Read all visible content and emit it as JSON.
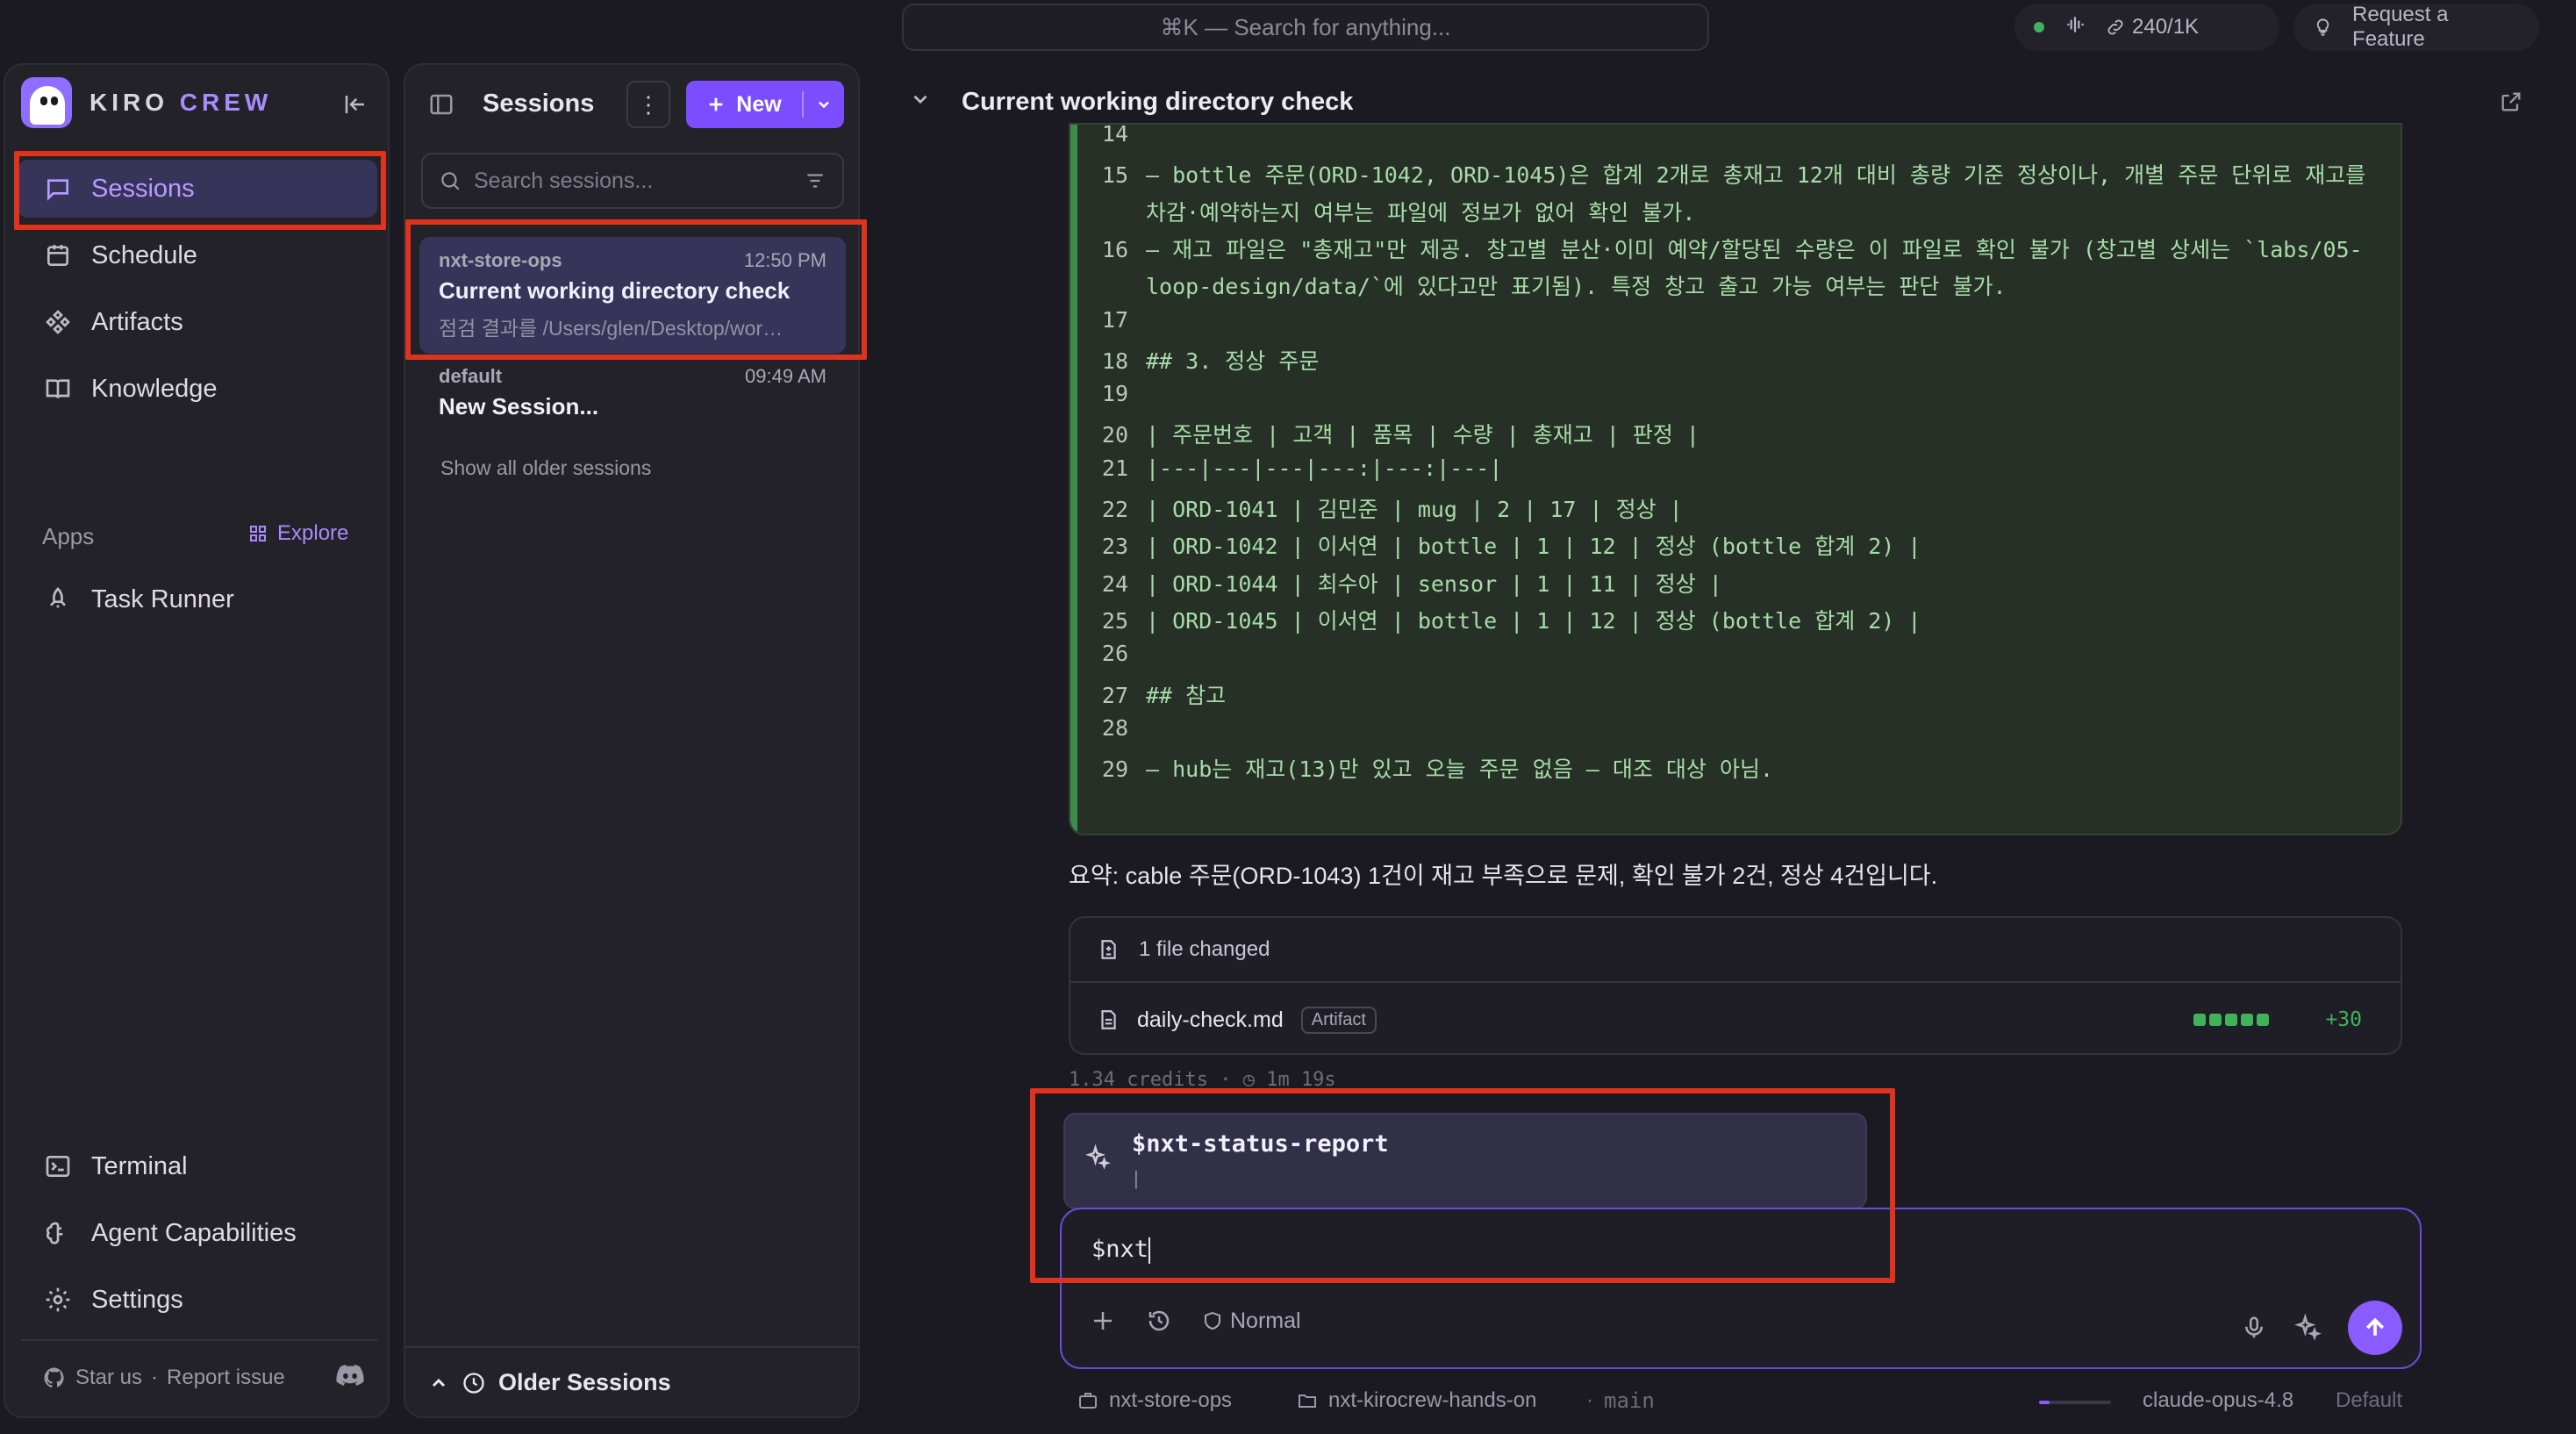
{
  "topbar": {
    "search_placeholder": "⌘K — Search for anything...",
    "credits": "240/1K",
    "request_feature": "Request a Feature"
  },
  "brand": {
    "first": "KIRO",
    "second": "CREW"
  },
  "nav": {
    "items": [
      {
        "label": "Sessions",
        "icon": "chat-icon",
        "active": true
      },
      {
        "label": "Schedule",
        "icon": "calendar-icon"
      },
      {
        "label": "Artifacts",
        "icon": "artifacts-icon"
      },
      {
        "label": "Knowledge",
        "icon": "book-icon"
      }
    ],
    "apps_label": "Apps",
    "explore_label": "Explore",
    "apps": [
      {
        "label": "Task Runner",
        "icon": "rocket-icon"
      }
    ],
    "bottom": [
      {
        "label": "Terminal",
        "icon": "terminal-icon"
      },
      {
        "label": "Agent Capabilities",
        "icon": "brain-icon"
      },
      {
        "label": "Settings",
        "icon": "gear-icon"
      }
    ],
    "footer": {
      "star": "Star us",
      "sep": "·",
      "report": "Report issue"
    }
  },
  "sessions": {
    "title": "Sessions",
    "new_label": "New",
    "search_placeholder": "Search sessions...",
    "list": [
      {
        "workspace": "nxt-store-ops",
        "time": "12:50 PM",
        "name": "Current working directory check",
        "sub": "점검 결과를 /Users/glen/Desktop/wor…"
      },
      {
        "workspace": "default",
        "time": "09:49 AM",
        "name": "New Session..."
      }
    ],
    "show_older": "Show all older sessions",
    "older_sessions": "Older Sessions"
  },
  "main": {
    "title": "Current working directory check",
    "code_lines": [
      {
        "n": "14",
        "text": ""
      },
      {
        "n": "15",
        "text": "– bottle 주문(ORD-1042, ORD-1045)은 합계 2개로 총재고 12개 대비 총량 기준 정상이나, 개별 주문 단위로 재고를"
      },
      {
        "n": "",
        "text": "차감·예약하는지 여부는 파일에 정보가 없어 확인 불가."
      },
      {
        "n": "16",
        "text": "– 재고 파일은 \"총재고\"만 제공. 창고별 분산·이미 예약/할당된 수량은 이 파일로 확인 불가 (창고별 상세는 `labs/05-"
      },
      {
        "n": "",
        "text": "loop-design/data/`에 있다고만 표기됨). 특정 창고 출고 가능 여부는 판단 불가."
      },
      {
        "n": "17",
        "text": ""
      },
      {
        "n": "18",
        "text": "## 3. 정상 주문"
      },
      {
        "n": "19",
        "text": ""
      },
      {
        "n": "20",
        "text": "| 주문번호 | 고객 | 품목 | 수량 | 총재고 | 판정 |"
      },
      {
        "n": "21",
        "text": "|---|---|---|---:|---:|---|"
      },
      {
        "n": "22",
        "text": "| ORD-1041 | 김민준 | mug | 2 | 17 | 정상 |"
      },
      {
        "n": "23",
        "text": "| ORD-1042 | 이서연 | bottle | 1 | 12 | 정상 (bottle 합계 2) |"
      },
      {
        "n": "24",
        "text": "| ORD-1044 | 최수아 | sensor | 1 | 11 | 정상 |"
      },
      {
        "n": "25",
        "text": "| ORD-1045 | 이서연 | bottle | 1 | 12 | 정상 (bottle 합계 2) |"
      },
      {
        "n": "26",
        "text": ""
      },
      {
        "n": "27",
        "text": "## 참고"
      },
      {
        "n": "28",
        "text": ""
      },
      {
        "n": "29",
        "text": "– hub는 재고(13)만 있고 오늘 주문 없음 — 대조 대상 아님."
      }
    ],
    "summary": "요약: cable 주문(ORD-1043) 1건이 재고 부족으로 문제, 확인 불가 2건, 정상 4건입니다.",
    "changes": {
      "header": "1 file changed",
      "file": "daily-check.md",
      "badge": "Artifact",
      "added": "+30"
    },
    "meta": {
      "credits": "1.34 credits",
      "duration": "1m 19s"
    },
    "suggestion": {
      "command": "$nxt-status-report",
      "sub": "|"
    },
    "composer": {
      "value": "$nxt",
      "mode": "Normal"
    },
    "status": {
      "workspace": "nxt-store-ops",
      "folder": "nxt-kirocrew-hands-on",
      "branch": "main",
      "model": "claude-opus-4.8",
      "profile": "Default",
      "context_usage": 0.15
    }
  },
  "colors": {
    "accent": "#8a5bff",
    "code_text": "#a7dca8",
    "highlight": "#e0331e"
  }
}
